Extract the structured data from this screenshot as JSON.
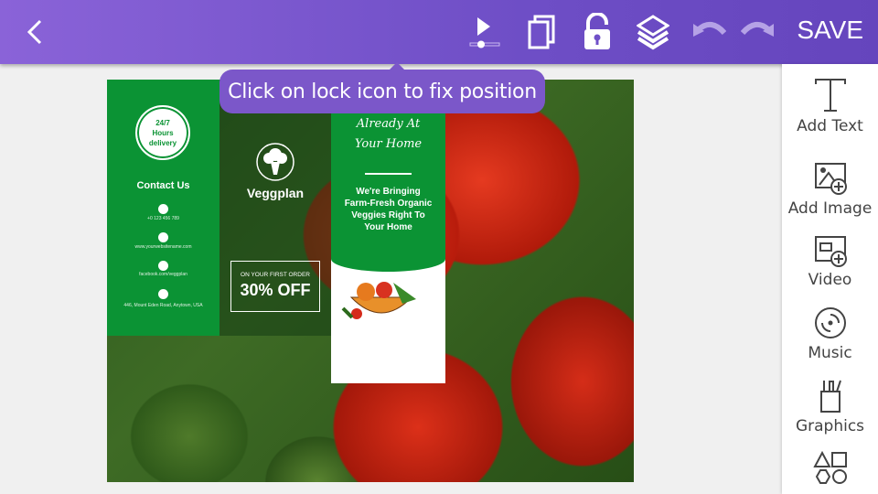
{
  "toolbar": {
    "back_icon": "chevron-left-icon",
    "save_label": "SAVE",
    "icons": [
      "preview-play-icon",
      "duplicate-icon",
      "unlock-icon",
      "layers-icon",
      "undo-icon",
      "redo-icon"
    ]
  },
  "tooltip": {
    "text": "Click on lock icon to fix position"
  },
  "sidebar": {
    "items": [
      {
        "label": "Add Text",
        "icon": "text-icon"
      },
      {
        "label": "Add Image",
        "icon": "add-image-icon"
      },
      {
        "label": "Video",
        "icon": "add-video-icon"
      },
      {
        "label": "Music",
        "icon": "music-disc-icon"
      },
      {
        "label": "Graphics",
        "icon": "graphics-icon"
      },
      {
        "label": "",
        "icon": "shapes-icon"
      }
    ]
  },
  "design": {
    "badge": "24/7 Hours delivery",
    "contact_title": "Contact Us",
    "phone": "+0 123 456 789",
    "website": "www.yourwebsitename.com",
    "facebook": "facebook.com/veggplan",
    "address": "446, Mount Eden Road, Anytown, USA",
    "brand": "Veggplan",
    "offer_small": "ON YOUR FIRST ORDER",
    "offer_big": "30% OFF",
    "headline": "Already At Your Home",
    "body": "We're Bringing Farm-Fresh Organic Veggies Right To Your Home",
    "accent": "#0b9334"
  }
}
